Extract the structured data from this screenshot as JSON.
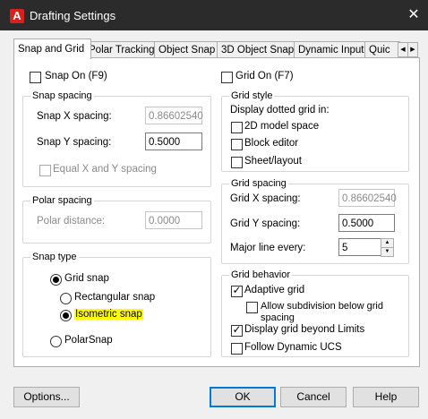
{
  "window": {
    "title": "Drafting Settings",
    "app_icon_letter": "A",
    "close_glyph": "✕"
  },
  "tabs": [
    {
      "label": "Snap and Grid",
      "active": true
    },
    {
      "label": "Polar Tracking"
    },
    {
      "label": "Object Snap"
    },
    {
      "label": "3D Object Snap"
    },
    {
      "label": "Dynamic Input"
    },
    {
      "label": "Quic"
    }
  ],
  "tab_scroll": {
    "left": "◀",
    "right": "▶"
  },
  "snap_on": {
    "label": "Snap On (F9)",
    "checked": false
  },
  "grid_on": {
    "label": "Grid On (F7)",
    "checked": false
  },
  "snap_spacing": {
    "title": "Snap spacing",
    "x_label": "Snap X spacing:",
    "x_value": "0.86602540",
    "y_label": "Snap Y spacing:",
    "y_value": "0.5000",
    "equal_label": "Equal X and Y spacing"
  },
  "polar_spacing": {
    "title": "Polar spacing",
    "distance_label": "Polar distance:",
    "distance_value": "0.0000"
  },
  "snap_type": {
    "title": "Snap type",
    "grid_snap": "Grid snap",
    "rectangular": "Rectangular snap",
    "isometric": "Isometric snap",
    "polar": "PolarSnap",
    "highlight_color": "#ffff00"
  },
  "grid_style": {
    "title": "Grid style",
    "subtitle": "Display dotted grid in:",
    "model_space": "2D model space",
    "block_editor": "Block editor",
    "sheet_layout": "Sheet/layout"
  },
  "grid_spacing": {
    "title": "Grid spacing",
    "x_label": "Grid X spacing:",
    "x_value": "0.86602540",
    "y_label": "Grid Y spacing:",
    "y_value": "0.5000",
    "major_label": "Major line every:",
    "major_value": "5"
  },
  "grid_behavior": {
    "title": "Grid behavior",
    "adaptive": "Adaptive grid",
    "allow_subdivision_line1": "Allow subdivision below grid",
    "allow_subdivision_line2": "spacing",
    "display_beyond": "Display grid beyond Limits",
    "follow_ucs": "Follow Dynamic UCS"
  },
  "buttons": {
    "options": "Options...",
    "ok": "OK",
    "cancel": "Cancel",
    "help": "Help"
  },
  "check_glyph": "✓",
  "spin_up": "▲",
  "spin_down": "▼"
}
